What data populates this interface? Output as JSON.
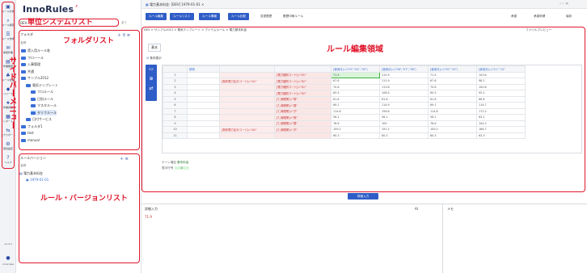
{
  "window": {
    "title": "電力基本料金: [DEV] 1979-01-01",
    "tab_close": "×"
  },
  "brand": {
    "name": "InnoRules",
    "mark": "´"
  },
  "annotations": {
    "system_list": "単位システムリスト",
    "folder_list": "フォルダリスト",
    "sidebar_menu": "サイドバーメニュー",
    "rule_version_list": "ルール・バージョンリスト",
    "rule_edit_area": "ルール編集領域"
  },
  "rail": [
    {
      "icon": "grid-icon",
      "label": "ルール分析"
    },
    {
      "icon": "search-icon",
      "label": "ルール検索"
    },
    {
      "icon": "users-icon",
      "label": "ルール作成"
    },
    {
      "icon": "chat-icon",
      "label": "承認作業"
    },
    {
      "icon": "doc-icon",
      "label": "作業履歴"
    },
    {
      "icon": "people-icon",
      "label": "ルール管理"
    },
    {
      "icon": "shield-icon",
      "label": "リリース"
    },
    {
      "icon": "star-icon",
      "label": "作業報告"
    },
    {
      "icon": "chart-icon",
      "label": "レポート"
    },
    {
      "icon": "io-icon",
      "label": "エクスポート"
    },
    {
      "icon": "gear-icon",
      "label": "環境設定"
    },
    {
      "icon": "help-icon",
      "label": "ヘルプ"
    }
  ],
  "rail_footer": {
    "version": "ver.8.0",
    "user": "innorules"
  },
  "system": {
    "name": "DEV",
    "search_label": "全て"
  },
  "folder_header": {
    "label": "フォルダ",
    "col": "名称"
  },
  "folders": [
    {
      "label": "賃入用ルール各"
    },
    {
      "label": "フローール"
    },
    {
      "label": "入事管理"
    },
    {
      "label": "共通"
    },
    {
      "label": "サンプル2012"
    },
    {
      "label": "電気テンプレート"
    },
    {
      "label": "フロルール"
    },
    {
      "label": "日別ルール"
    },
    {
      "label": "マスタルール"
    },
    {
      "label": "タリフルール"
    },
    {
      "label": "日付サービス"
    },
    {
      "label": "フォルダ1"
    },
    {
      "label": "test"
    },
    {
      "label": "manual"
    }
  ],
  "version_header": {
    "label": "ルールバージョン",
    "col": "名称"
  },
  "versions": [
    {
      "name": "電力基本料金",
      "date": "1979-01-01"
    }
  ],
  "toolbar": {
    "new": "ルール編集",
    "list": "ルールリスト",
    "info": "ルール情報",
    "compare": "ルール比較",
    "history": "変更履歴",
    "print": "履歴印刷ルール",
    "approve": "承認",
    "approve_apply": "承認申請",
    "save": "保存"
  },
  "breadcrumb": [
    "DEV",
    "サンプル2012",
    "電気テンプレート",
    "アイテムルール",
    "電力基本料金"
  ],
  "breadcrumb_right": "ファイルプレビュー",
  "grid_toggle": "条件表示",
  "subtab": "基本",
  "columns": [
    "",
    "説明",
    "",
    "",
    "[使用月]=(\"03\",\"04\",\"05\")",
    "[使用月]=(\"06\",\"07\",\"08\")",
    "[使用月]=(\"09\",\"10\")",
    "[使用月]=(\"11\",\"12\""
  ],
  "rows": [
    {
      "n": "1",
      "c1": "",
      "c2": "[電力区分コード2]=\"01\"",
      "c3": "[電力種別コード]=\"01\"",
      "v": [
        "71.9",
        "115.9",
        "71.9",
        "103.6"
      ]
    },
    {
      "n": "2",
      "c1": "[契約電力区分コード]=\"A1\"",
      "c2": "",
      "c3": "[電力種別コード]=\"02\"",
      "v": [
        "67.6",
        "111.9",
        "67.6",
        "98.2"
      ]
    },
    {
      "n": "3",
      "c1": "",
      "c2": "[電力区分コード2]=\"04\"",
      "c3": "[電力種別コード]=\"01\"",
      "v": [
        "70.8",
        "113.8",
        "70.8",
        "100.6"
      ]
    },
    {
      "n": "4",
      "c1": "",
      "c2": "",
      "c3": "[電力種別コード]=\"02\"",
      "v": [
        "65.5",
        "108.5",
        "65.5",
        "95.2"
      ]
    },
    {
      "n": "5",
      "c1": "",
      "c2": "",
      "c3": "[T_時間帯]=\"夜\"",
      "v": [
        "61.6",
        "61.6",
        "61.6",
        "66.6"
      ]
    },
    {
      "n": "6",
      "c1": "",
      "c2": "[電力区分コード2]=\"01\"",
      "c3": "[T_時間帯]=\"昼\"",
      "v": [
        "69.1",
        "114.9",
        "69.1",
        "114.7"
      ]
    },
    {
      "n": "7",
      "c1": "",
      "c2": "",
      "c3": "[T_時間帯]=\"夕\"",
      "v": [
        "114.8",
        "156.6",
        "114.8",
        "172.2"
      ]
    },
    {
      "n": "8",
      "c1": "",
      "c2": "",
      "c3": "[T_時間帯]=\"夜\"",
      "v": [
        "56.1",
        "56.1",
        "56.1",
        "63.1"
      ]
    },
    {
      "n": "9",
      "c1": "",
      "c2": "[電力区分コード2]=\"03\"",
      "c3": "[T_時間帯]=\"昼\"",
      "v": [
        "78.6",
        "109",
        "78.6",
        "104.2"
      ]
    },
    {
      "n": "10",
      "c1": "[契約電力区分コード]=\"A2\"",
      "c2": "",
      "c3": "[T_時間帯]=\"夕\"",
      "v": [
        "109.2",
        "191.1",
        "109.2",
        "186.7"
      ]
    },
    {
      "n": "11",
      "c1": "",
      "c2": "",
      "c3": "",
      "v": [
        "60.3",
        "60.3",
        "60.3",
        "63.3"
      ]
    }
  ],
  "form": {
    "label1": "ケーン項目",
    "value1": "基本料金",
    "label2": "表示行号",
    "value2": "0"
  },
  "detail_button": "詳細入力",
  "bottom": {
    "left_title": "詳細入力",
    "left_value": "71.9",
    "ai": "AI",
    "right_title": "メモ"
  }
}
